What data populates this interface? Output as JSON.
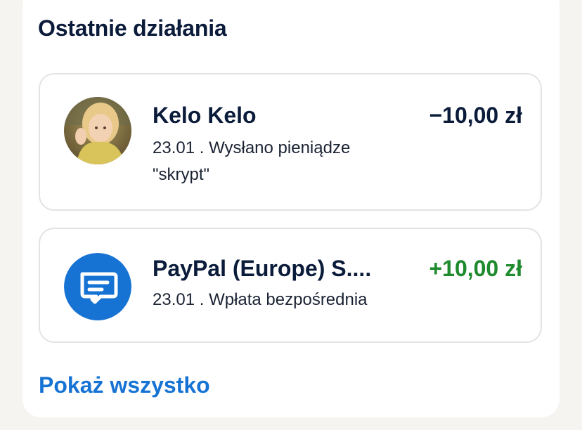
{
  "section": {
    "title": "Ostatnie działania",
    "show_all_label": "Pokaż wszystko"
  },
  "activities": [
    {
      "name": "Kelo Kelo",
      "amount": "−10,00 zł",
      "description": "23.01 . Wysłano pieniądze \"skrypt\"",
      "amount_color": "#0b1b3a",
      "icon": "user-photo-avatar"
    },
    {
      "name": "PayPal (Europe) S....",
      "amount": "+10,00 zł",
      "description": "23.01 . Wpłata bezpośrednia",
      "amount_color": "#1f8a2e",
      "icon": "bank-transfer-icon"
    }
  ],
  "colors": {
    "title": "#0b1b3a",
    "link": "#1673d4",
    "positive": "#1f8a2e",
    "icon_bg": "#1673d4"
  }
}
